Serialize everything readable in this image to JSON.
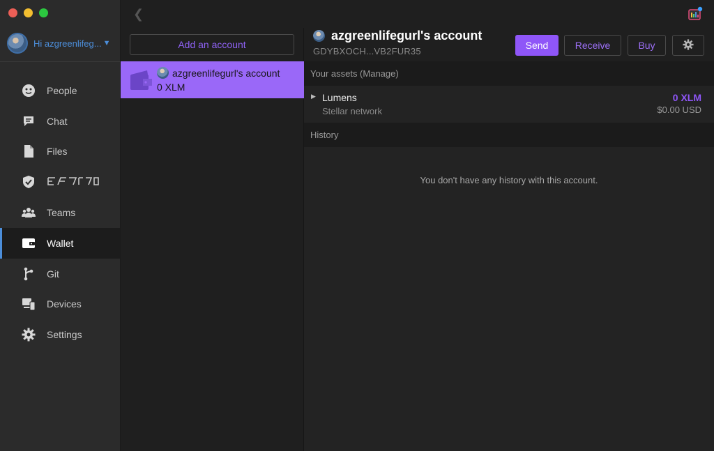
{
  "sidebar": {
    "user_label": "Hi azgreenlifeg...",
    "items": [
      {
        "label": "People",
        "icon": "people-icon"
      },
      {
        "label": "Chat",
        "icon": "chat-icon"
      },
      {
        "label": "Files",
        "icon": "files-icon"
      },
      {
        "label": "",
        "icon": "crypto-shield-icon"
      },
      {
        "label": "Teams",
        "icon": "teams-icon"
      },
      {
        "label": "Wallet",
        "icon": "wallet-icon",
        "active": true
      },
      {
        "label": "Git",
        "icon": "git-icon"
      },
      {
        "label": "Devices",
        "icon": "devices-icon"
      },
      {
        "label": "Settings",
        "icon": "gear-icon"
      }
    ]
  },
  "accounts": {
    "add_label": "Add an account",
    "list": [
      {
        "name": "azgreenlifegurl's account",
        "balance": "0 XLM",
        "selected": true
      }
    ]
  },
  "detail": {
    "title": "azgreenlifegurl's account",
    "key": "GDYBXOCH...VB2FUR35",
    "buttons": {
      "send": "Send",
      "receive": "Receive",
      "buy": "Buy"
    },
    "assets_header": "Your assets (Manage)",
    "asset": {
      "name": "Lumens",
      "network": "Stellar network",
      "amount": "0 XLM",
      "usd": "$0.00 USD"
    },
    "history_header": "History",
    "history_empty": "You don't have any history with this account."
  },
  "colors": {
    "accent": "#8f56f8",
    "selected": "#9a68f8",
    "link_blue": "#4c8eda"
  }
}
